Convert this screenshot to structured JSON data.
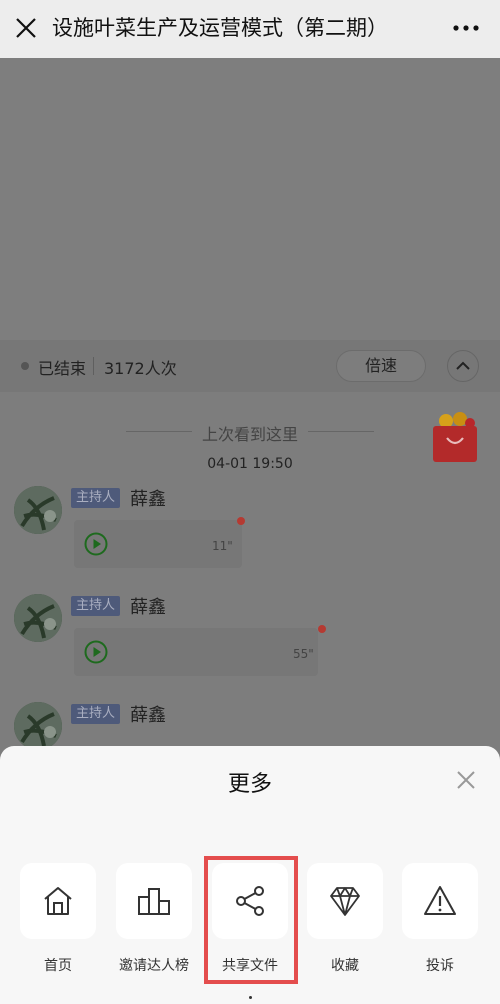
{
  "header": {
    "title": "设施叶菜生产及运营模式（第二期）",
    "close_icon": "close-icon",
    "more_icon": "more-dots-icon"
  },
  "live_info": {
    "status": "已结束",
    "views": "3172人次",
    "speed_label": "倍速"
  },
  "chat": {
    "last_seen_label": "上次看到这里",
    "timestamp": "04-01 19:50",
    "messages": [
      {
        "badge": "主持人",
        "name": "薛鑫",
        "duration": "11\""
      },
      {
        "badge": "主持人",
        "name": "薛鑫",
        "duration": "55\""
      },
      {
        "badge": "主持人",
        "name": "薛鑫"
      }
    ]
  },
  "sheet": {
    "title": "更多",
    "items": [
      {
        "label": "首页",
        "icon": "home-icon"
      },
      {
        "label": "邀请达人榜",
        "icon": "leaderboard-icon"
      },
      {
        "label": "共享文件",
        "icon": "share-icon"
      },
      {
        "label": "收藏",
        "icon": "diamond-icon"
      },
      {
        "label": "投诉",
        "icon": "warning-icon"
      }
    ]
  },
  "colors": {
    "highlight": "#e44d4d",
    "overlay": "#7d7d7d",
    "sheet_bg": "#f7f7f7"
  }
}
